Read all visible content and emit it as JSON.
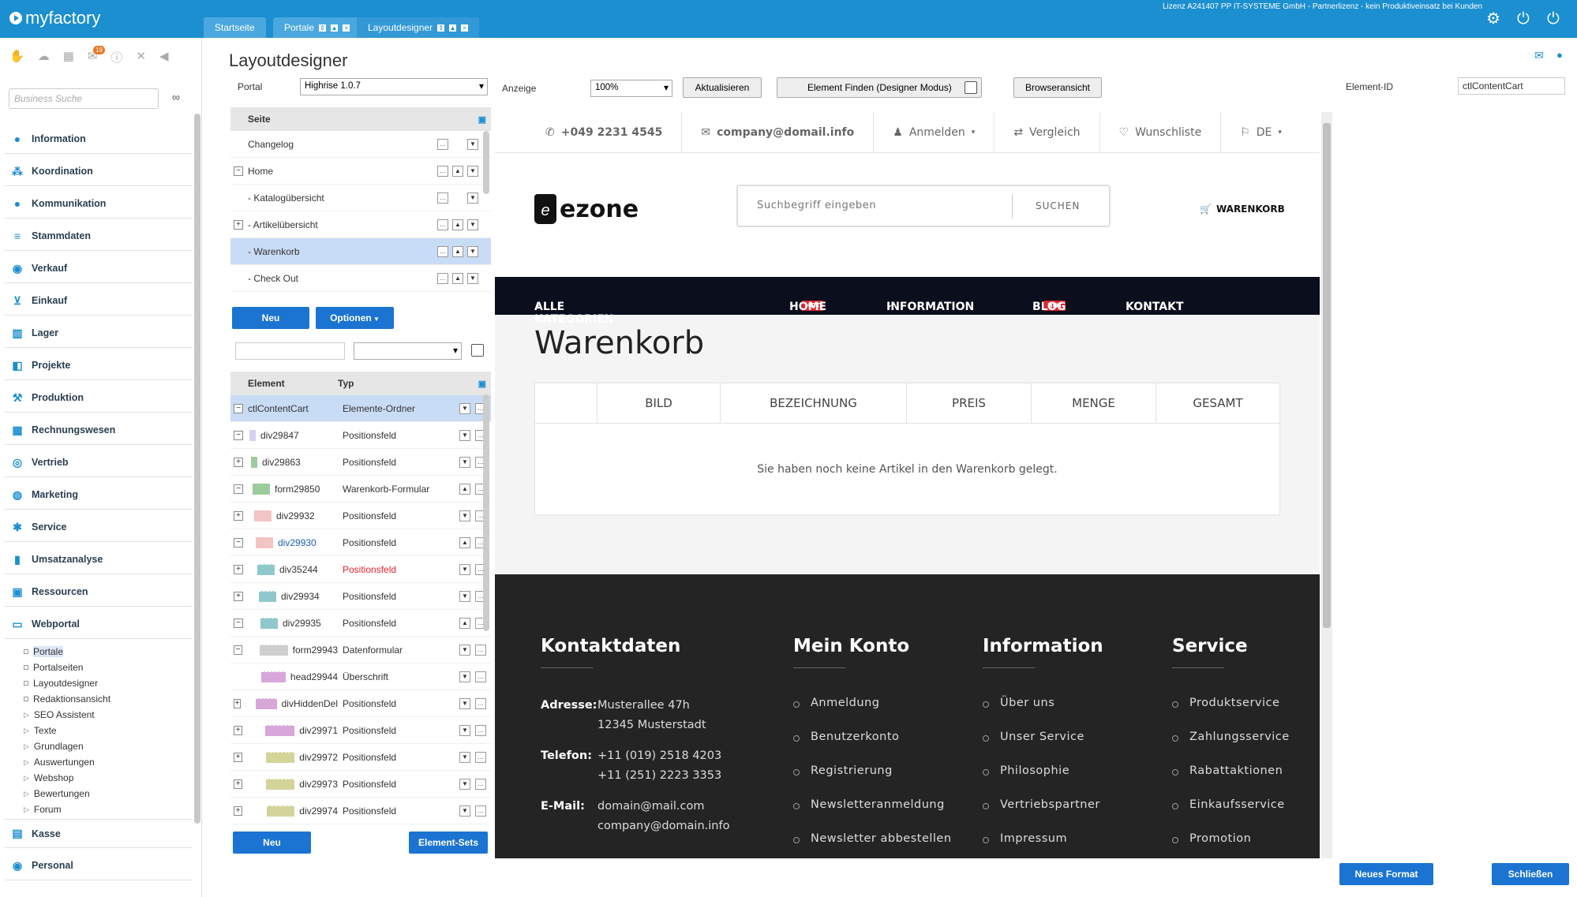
{
  "app": {
    "logo": "myfactory",
    "license": "Lizenz A241407 PP IT-SYSTEME GmbH - Partnerlizenz - kein Produktiveinsatz bei Kunden"
  },
  "tabs": [
    {
      "label": "Startseite"
    },
    {
      "label": "Portale"
    },
    {
      "label": "Layoutdesigner"
    }
  ],
  "sidebar": {
    "badge": "19",
    "search_placeholder": "Business Suche",
    "items": [
      "Information",
      "Koordination",
      "Kommunikation",
      "Stammdaten",
      "Verkauf",
      "Einkauf",
      "Lager",
      "Projekte",
      "Produktion",
      "Rechnungswesen",
      "Vertrieb",
      "Marketing",
      "Service",
      "Umsatzanalyse",
      "Ressourcen",
      "Webportal"
    ],
    "subitems": [
      "Portale",
      "Portalseiten",
      "Layoutdesigner",
      "Redaktionsansicht",
      "SEO Assistent",
      "Texte",
      "Grundlagen",
      "Auswertungen",
      "Webshop",
      "Bewertungen",
      "Forum"
    ],
    "bottom_items": [
      "Kasse",
      "Personal"
    ]
  },
  "designer": {
    "title": "Layoutdesigner",
    "portal_label": "Portal",
    "portal_value": "Highrise 1.0.7",
    "anzeige_label": "Anzeige",
    "anzeige_value": "100%",
    "refresh_label": "Aktualisieren",
    "find_label": "Element Finden (Designer Modus)",
    "browser_label": "Browseransicht",
    "elementid_label": "Element-ID",
    "elementid_value": "ctlContentCart",
    "neu_label": "Neu",
    "optionen_label": "Optionen",
    "elementsets_label": "Element-Sets",
    "neues_format_label": "Neues Format",
    "schliessen_label": "Schließen"
  },
  "pages_table": {
    "header": "Seite",
    "rows": [
      {
        "label": "Changelog",
        "pm": ""
      },
      {
        "label": "Home",
        "pm": "−"
      },
      {
        "label": "- Katalogübersicht",
        "pm": ""
      },
      {
        "label": "- Artikelübersicht",
        "pm": "+"
      },
      {
        "label": "- Warenkorb",
        "pm": ""
      },
      {
        "label": "- Check Out",
        "pm": ""
      }
    ]
  },
  "elements_table": {
    "col_element": "Element",
    "col_typ": "Typ",
    "rows": [
      {
        "name": "ctlContentCart",
        "typ": "Elemente-Ordner",
        "pm": "−",
        "swatch": ""
      },
      {
        "name": "div29847",
        "typ": "Positionsfeld",
        "pm": "−",
        "swatch": "#d7d0ee"
      },
      {
        "name": "div29863",
        "typ": "Positionsfeld",
        "pm": "+",
        "swatch": "#9ccc9c"
      },
      {
        "name": "form29850",
        "typ": "Warenkorb-Formular",
        "pm": "−",
        "swatch": "#9ccc9c"
      },
      {
        "name": "div29932",
        "typ": "Positionsfeld",
        "pm": "+",
        "swatch": "#f3c4c4"
      },
      {
        "name": "div29930",
        "typ": "Positionsfeld",
        "pm": "−",
        "swatch": "#f3c4c4"
      },
      {
        "name": "div35244",
        "typ": "Positionsfeld",
        "pm": "+",
        "swatch": "#8fc8cc"
      },
      {
        "name": "div29934",
        "typ": "Positionsfeld",
        "pm": "+",
        "swatch": "#8fc8cc"
      },
      {
        "name": "div29935",
        "typ": "Positionsfeld",
        "pm": "−",
        "swatch": "#8fc8cc"
      },
      {
        "name": "form29943",
        "typ": "Datenformular",
        "pm": "−",
        "swatch": "#cfcfcf"
      },
      {
        "name": "head29944",
        "typ": "Überschrift",
        "pm": "",
        "swatch": "#d8a6d8"
      },
      {
        "name": "divHiddenDel",
        "typ": "Positionsfeld",
        "pm": "+",
        "swatch": "#d8a6d8"
      },
      {
        "name": "div29971",
        "typ": "Positionsfeld",
        "pm": "+",
        "swatch": "#d8a6d8"
      },
      {
        "name": "div29972",
        "typ": "Positionsfeld",
        "pm": "+",
        "swatch": "#d4d49a"
      },
      {
        "name": "div29973",
        "typ": "Positionsfeld",
        "pm": "+",
        "swatch": "#d4d49a"
      },
      {
        "name": "div29974",
        "typ": "Positionsfeld",
        "pm": "+",
        "swatch": "#d4d49a"
      }
    ]
  },
  "preview": {
    "phone": "+049 2231 4545",
    "email": "company@domail.info",
    "login": "Anmelden",
    "compare": "Vergleich",
    "wishlist": "Wunschliste",
    "lang": "DE",
    "logo": "ezone",
    "search_placeholder": "Suchbegriff eingeben",
    "search_btn": "SUCHEN",
    "cart": "WARENKORB",
    "nav": [
      "ALLE KATEGORIEN",
      "HOME",
      "INFORMATION",
      "BLOG",
      "KONTAKT"
    ],
    "hot": "HOT",
    "page_title": "Warenkorb",
    "cart_cols": [
      "BILD",
      "BEZEICHNUNG",
      "PREIS",
      "MENGE",
      "GESAMT"
    ],
    "empty_msg": "Sie haben noch keine Artikel in den Warenkorb gelegt.",
    "footer": {
      "contact_title": "Kontaktdaten",
      "addr_label": "Adresse:",
      "addr1": "Musterallee 47h",
      "addr2": "12345 Musterstadt",
      "tel_label": "Telefon:",
      "tel1": "+11 (019) 2518 4203",
      "tel2": "+11 (251) 2223 3353",
      "mail_label": "E-Mail:",
      "mail1": "domain@mail.com",
      "mail2": "company@domain.info",
      "konto_title": "Mein Konto",
      "konto": [
        "Anmeldung",
        "Benutzerkonto",
        "Registrierung",
        "Newsletteranmeldung",
        "Newsletter abbestellen"
      ],
      "info_title": "Information",
      "info": [
        "Über uns",
        "Unser Service",
        "Philosophie",
        "Vertriebspartner",
        "Impressum"
      ],
      "service_title": "Service",
      "service": [
        "Produktservice",
        "Zahlungsservice",
        "Rabattaktionen",
        "Einkaufsservice",
        "Promotion"
      ]
    }
  }
}
